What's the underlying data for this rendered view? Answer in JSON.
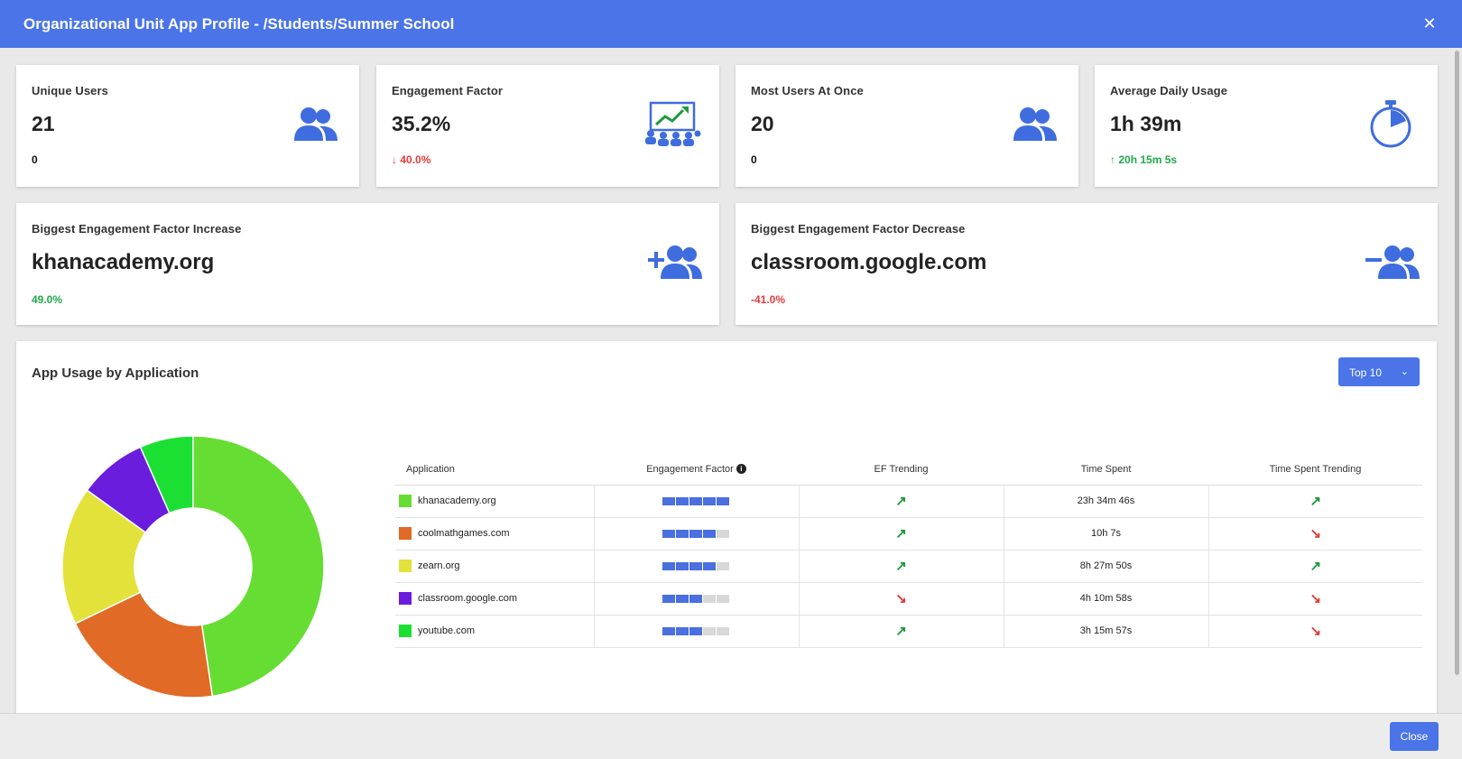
{
  "header": {
    "title": "Organizational Unit App Profile - /Students/Summer School",
    "close_icon": "close-icon"
  },
  "stats": [
    {
      "label": "Unique Users",
      "value": "21",
      "sub": "0",
      "sub_trend": "none",
      "icon": "users-icon"
    },
    {
      "label": "Engagement Factor",
      "value": "35.2%",
      "sub": "40.0%",
      "sub_trend": "down",
      "icon": "classroom-chart-icon"
    },
    {
      "label": "Most Users At Once",
      "value": "20",
      "sub": "0",
      "sub_trend": "none",
      "icon": "users-icon"
    },
    {
      "label": "Average Daily Usage",
      "value": "1h 39m",
      "sub": "20h 15m 5s",
      "sub_trend": "up",
      "icon": "stopwatch-icon"
    }
  ],
  "highlights": [
    {
      "label": "Biggest Engagement Factor Increase",
      "value": "khanacademy.org",
      "sub": "49.0%",
      "sub_trend": "up",
      "icon": "add-users-icon"
    },
    {
      "label": "Biggest Engagement Factor Decrease",
      "value": "classroom.google.com",
      "sub": "-41.0%",
      "sub_trend": "down",
      "icon": "remove-users-icon"
    }
  ],
  "usage": {
    "heading": "App Usage by Application",
    "dropdown": {
      "selected": "Top 10"
    },
    "columns": [
      "Application",
      "Engagement Factor",
      "EF Trending",
      "Time Spent",
      "Time Spent Trending"
    ],
    "rows": [
      {
        "app": "khanacademy.org",
        "color": "#66dd33",
        "ef_level": 5,
        "ef_trend": "up",
        "time": "23h 34m 46s",
        "time_trend": "up"
      },
      {
        "app": "coolmathgames.com",
        "color": "#e06a26",
        "ef_level": 4,
        "ef_trend": "up",
        "time": "10h 7s",
        "time_trend": "down"
      },
      {
        "app": "zearn.org",
        "color": "#e2e23a",
        "ef_level": 4,
        "ef_trend": "up",
        "time": "8h 27m 50s",
        "time_trend": "up"
      },
      {
        "app": "classroom.google.com",
        "color": "#6a1ddd",
        "ef_level": 3,
        "ef_trend": "down",
        "time": "4h 10m 58s",
        "time_trend": "down"
      },
      {
        "app": "youtube.com",
        "color": "#1be033",
        "ef_level": 3,
        "ef_trend": "up",
        "time": "3h 15m 57s",
        "time_trend": "down"
      }
    ]
  },
  "chart_data": {
    "type": "pie",
    "donut": true,
    "categories": [
      "khanacademy.org",
      "coolmathgames.com",
      "zearn.org",
      "classroom.google.com",
      "youtube.com"
    ],
    "values": [
      23.58,
      10.0,
      8.46,
      4.18,
      3.27
    ],
    "colors": [
      "#66dd33",
      "#e06a26",
      "#e2e23a",
      "#6a1ddd",
      "#1be033"
    ]
  },
  "footer": {
    "close_label": "Close"
  }
}
